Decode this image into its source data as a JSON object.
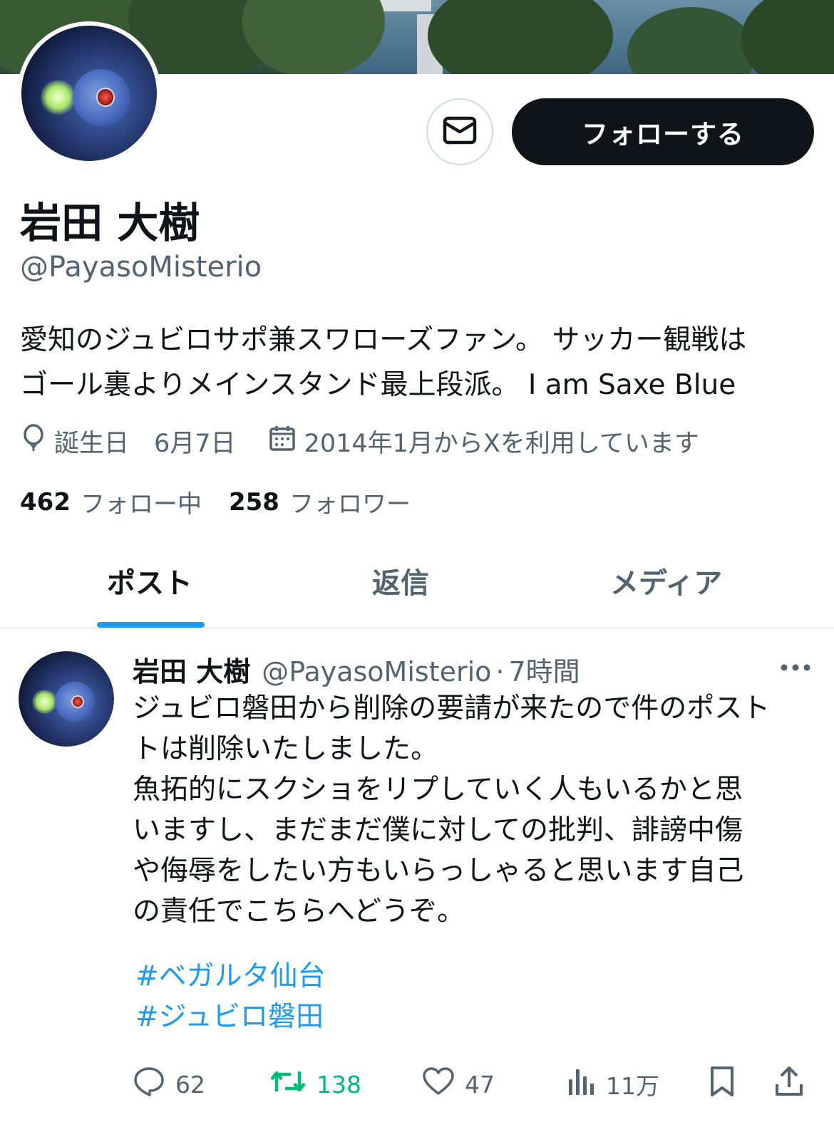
{
  "profile": {
    "display_name": "岩田 大樹",
    "handle": "@PayasoMisterio",
    "bio_lines": [
      "愛知のジュビロサポ兼スワローズファン。 サッカー観戦は",
      "ゴール裏よりメインスタンド最上段派。 I am Saxe Blue"
    ],
    "birthday": "誕生日　6月7日",
    "joined": "2014年1月からXを利用しています",
    "following_count": "462",
    "following_label": "フォロー中",
    "followers_count": "258",
    "followers_label": "フォロワー",
    "follow_button": "フォローする",
    "message_icon": "envelope-icon"
  },
  "tabs": [
    {
      "label": "ポスト",
      "active": true
    },
    {
      "label": "返信",
      "active": false
    },
    {
      "label": "メディア",
      "active": false
    }
  ],
  "post": {
    "author_name": "岩田 大樹",
    "author_handle": "@PayasoMisterio",
    "separator": "·",
    "time": "7時間",
    "text_lines": [
      "ジュビロ磐田から削除の要請が来たので件のポスト",
      "トは削除いたしました。",
      "魚拓的にスクショをリプしていく人もいるかと思",
      "いますし、まだまだ僕に対しての批判、誹謗中傷",
      "や侮辱をしたい方もいらっしゃると思います自己",
      "の責任でこちらへどうぞ。"
    ],
    "hashtags": [
      "#ベガルタ仙台",
      "#ジュビロ磐田"
    ],
    "replies": "62",
    "reposts": "138",
    "likes": "47",
    "views": "11万"
  },
  "colors": {
    "accent": "#1d9bf0",
    "repost_active": "#00ba7c",
    "text_primary": "#0f1419",
    "text_secondary": "#536471"
  }
}
